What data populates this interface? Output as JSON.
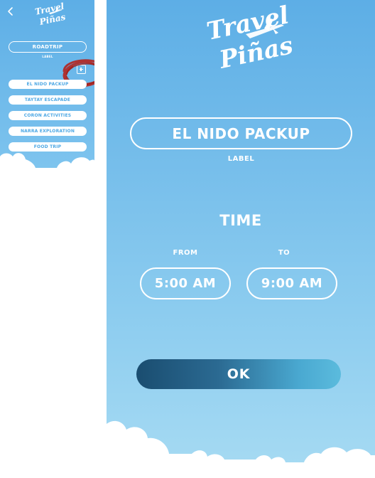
{
  "brand": {
    "logo_text_line1": "Travel",
    "logo_text_line2": "Piñas"
  },
  "sidebar": {
    "back_icon": "chevron-left-icon",
    "roadtrip_label": "ROADTRIP",
    "label_caption": "LABEL",
    "add_icon": "plus-square-icon",
    "items": [
      {
        "label": "EL NIDO PACKUP"
      },
      {
        "label": "TAYTAY ESCAPADE"
      },
      {
        "label": "CORON ACTIVITIES"
      },
      {
        "label": "NARRA EXPLORATION"
      },
      {
        "label": "FOOD TRIP"
      }
    ]
  },
  "main": {
    "name_value": "EL NIDO PACKUP",
    "label_caption": "LABEL",
    "time_title": "TIME",
    "from_label": "FROM",
    "to_label": "TO",
    "from_value": "5:00 AM",
    "to_value": "9:00 AM",
    "ok_label": "OK"
  },
  "colors": {
    "sky_top": "#5daee6",
    "sky_bottom": "#a7dbf3",
    "white": "#ffffff",
    "item_text": "#4ea8e4",
    "ok_dark": "#1a4d70",
    "ok_light": "#5bbbdd",
    "annotation_red": "#b5231e"
  }
}
